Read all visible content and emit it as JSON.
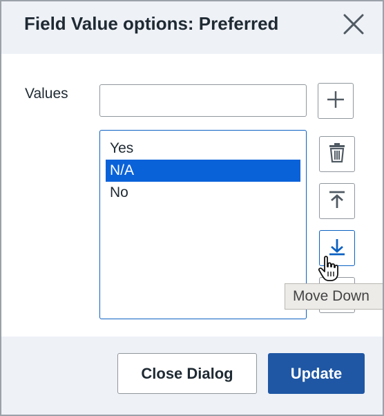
{
  "dialog": {
    "title": "Field Value options: Preferred",
    "close_icon": "close-icon"
  },
  "values": {
    "label": "Values",
    "input_value": "",
    "input_placeholder": "",
    "items": [
      {
        "label": "Yes",
        "selected": false
      },
      {
        "label": "N/A",
        "selected": true
      },
      {
        "label": "No",
        "selected": false
      }
    ]
  },
  "actions": {
    "add_icon": "plus-icon",
    "delete_icon": "trash-icon",
    "move_top_icon": "move-to-top-icon",
    "move_down_icon": "move-down-icon",
    "move_bottom_icon": "move-to-bottom-icon"
  },
  "tooltip": {
    "text": "Move Down"
  },
  "footer": {
    "close_label": "Close Dialog",
    "update_label": "Update"
  },
  "colors": {
    "accent": "#0a62d9",
    "primary_button": "#1f57a4",
    "header_bg": "#eef1f6"
  }
}
